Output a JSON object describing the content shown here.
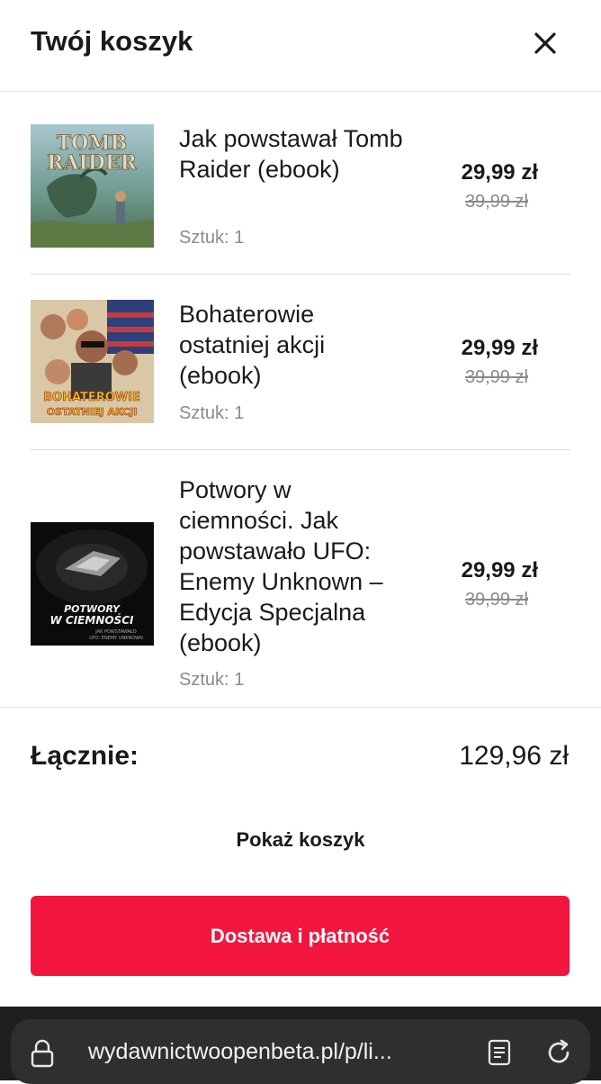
{
  "header": {
    "title": "Twój koszyk"
  },
  "items": [
    {
      "name": "Jak powstawał Tomb Raider (ebook)",
      "qty": "Sztuk: 1",
      "price": "29,99 zł",
      "old_price": "39,99 zł",
      "cover_text": [
        "TOMB",
        "RAIDER"
      ]
    },
    {
      "name": "Bohaterowie ostatniej akcji (ebook)",
      "qty": "Sztuk: 1",
      "price": "29,99 zł",
      "old_price": "39,99 zł",
      "cover_text": [
        "BOHATEROWIE",
        "OSTATNIEJ AKCJI"
      ]
    },
    {
      "name": "Potwory w ciemności. Jak powstawało UFO: Enemy Unknown – Edycja Specjalna (ebook)",
      "qty": "Sztuk: 1",
      "price": "29,99 zł",
      "old_price": "39,99 zł",
      "cover_text": [
        "POTWORY",
        "W CIEMNOŚCI",
        "JAK POWSTAWAŁO",
        "UFO: ENEMY UNKNOWN"
      ]
    }
  ],
  "summary": {
    "label": "Łącznie:",
    "value": "129,96 zł"
  },
  "actions": {
    "show_cart": "Pokaż koszyk",
    "checkout": "Dostawa i płatność"
  },
  "browser": {
    "url": "wydawnictwoopenbeta.pl/p/li..."
  },
  "colors": {
    "accent": "#f2163f"
  },
  "icons": [
    "close-icon",
    "lock-icon",
    "reader-icon",
    "reload-icon"
  ]
}
